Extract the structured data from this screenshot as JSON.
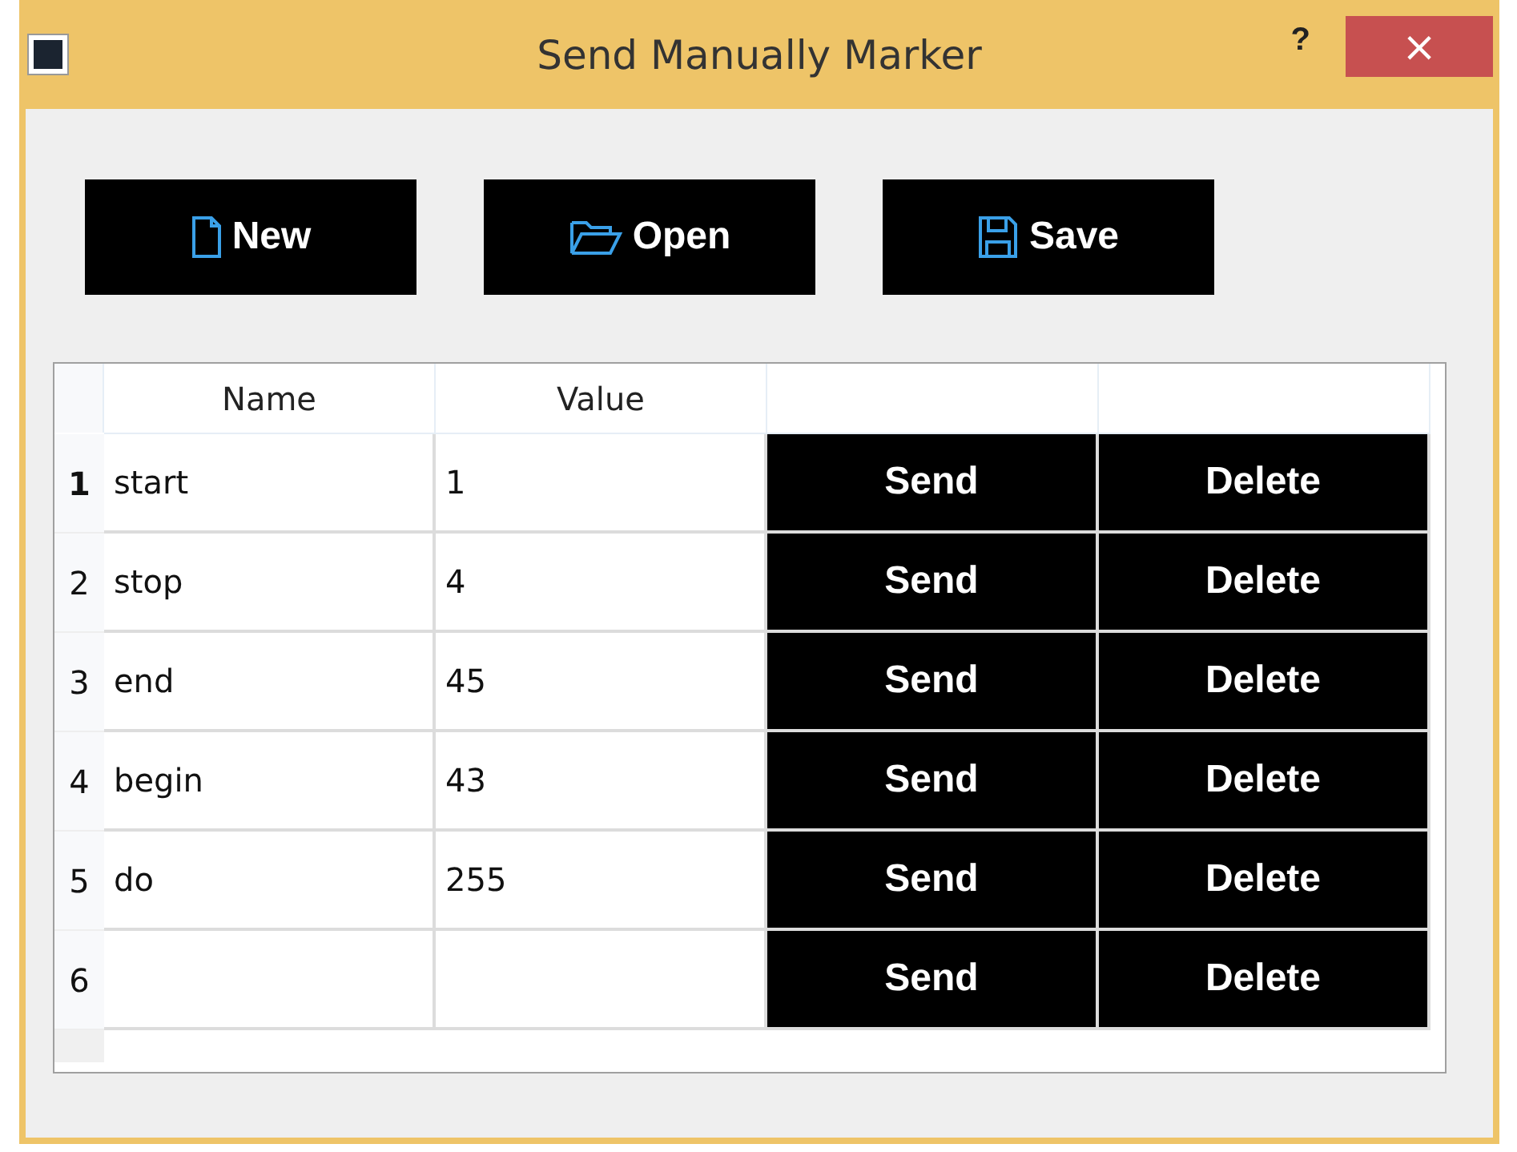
{
  "window": {
    "title": "Send Manually Marker",
    "help": "?",
    "close": "×"
  },
  "toolbar": [
    {
      "kind": "new",
      "label": "New"
    },
    {
      "kind": "open",
      "label": "Open"
    },
    {
      "kind": "save",
      "label": "Save"
    }
  ],
  "table": {
    "columns": [
      "Name",
      "Value"
    ],
    "rows": [
      {
        "number": "1",
        "selected": true,
        "name": "start",
        "value": "1",
        "send": "Send",
        "delete": "Delete"
      },
      {
        "number": "2",
        "selected": false,
        "name": "stop",
        "value": "4",
        "send": "Send",
        "delete": "Delete"
      },
      {
        "number": "3",
        "selected": false,
        "name": "end",
        "value": "45",
        "send": "Send",
        "delete": "Delete"
      },
      {
        "number": "4",
        "selected": false,
        "name": "begin",
        "value": "43",
        "send": "Send",
        "delete": "Delete"
      },
      {
        "number": "5",
        "selected": false,
        "name": "do",
        "value": "255",
        "send": "Send",
        "delete": "Delete"
      },
      {
        "number": "6",
        "selected": false,
        "name": "",
        "value": "",
        "send": "Send",
        "delete": "Delete"
      }
    ]
  }
}
